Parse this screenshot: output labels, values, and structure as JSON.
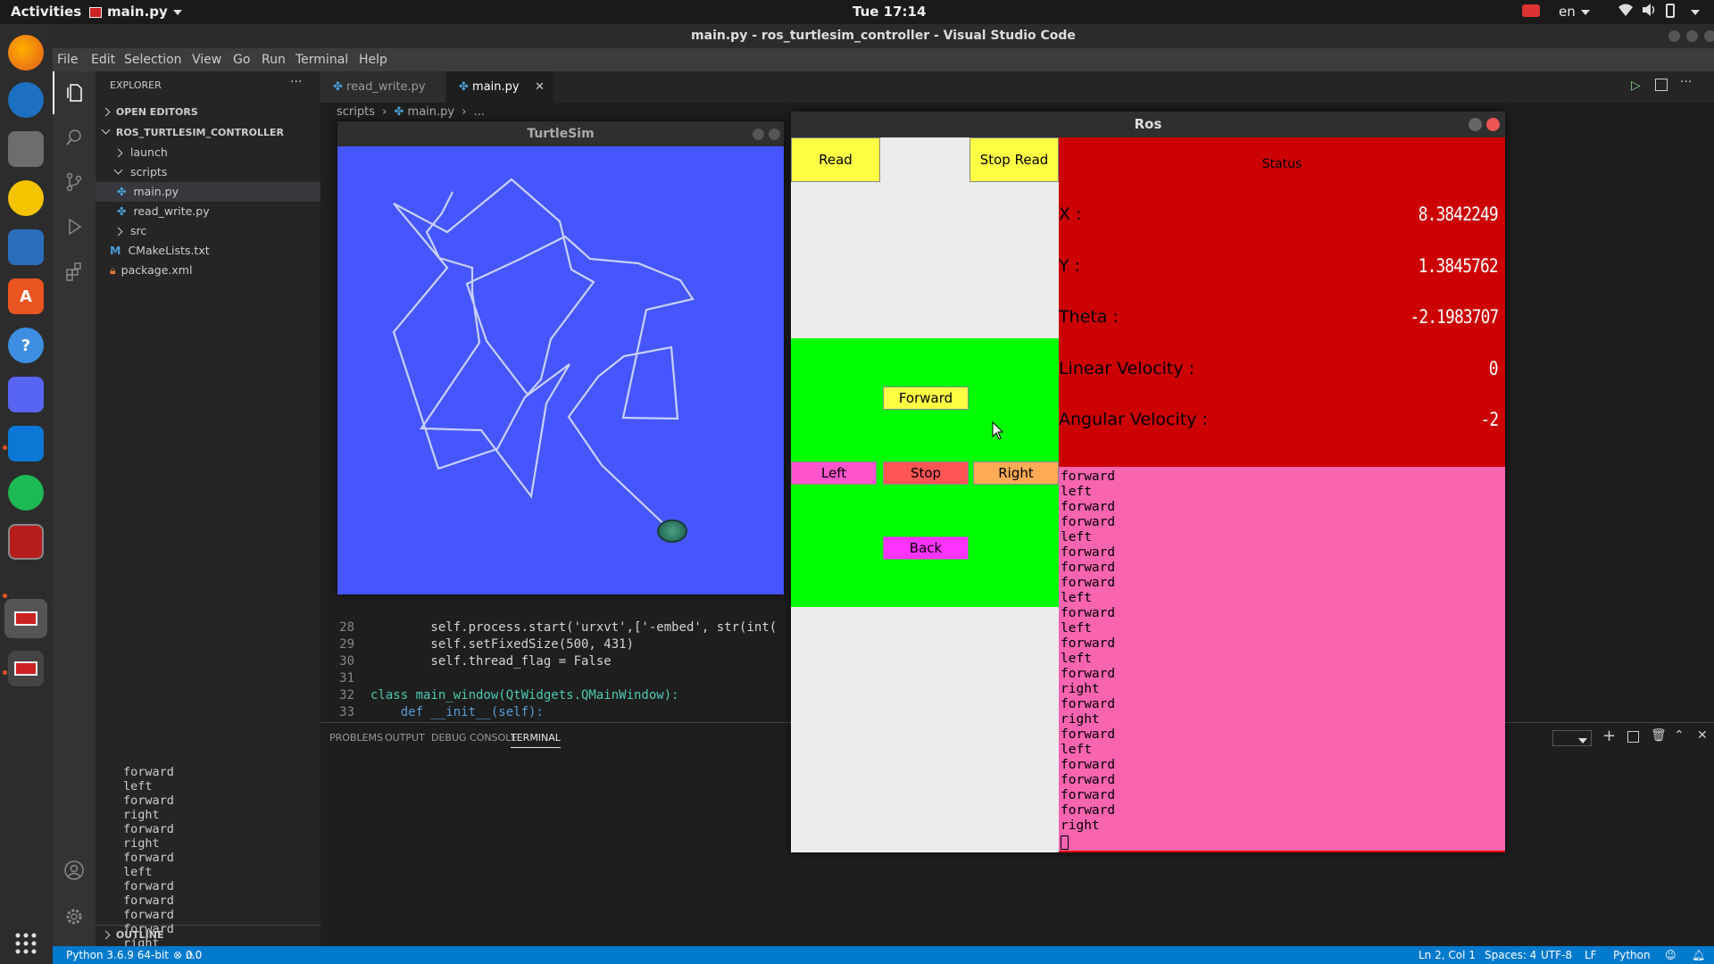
{
  "topbar": {
    "activities": "Activities",
    "app_menu": "main.py",
    "clock": "Tue 17:14",
    "language": "en"
  },
  "vscode": {
    "window_title": "main.py - ros_turtlesim_controller - Visual Studio Code",
    "menu": [
      "File",
      "Edit",
      "Selection",
      "View",
      "Go",
      "Run",
      "Terminal",
      "Help"
    ],
    "explorer": {
      "header": "EXPLORER",
      "open_editors": "OPEN EDITORS",
      "project": "ROS_TURTLESIM_CONTROLLER",
      "tree": [
        "launch",
        "scripts",
        "main.py",
        "read_write.py",
        "src",
        "CMakeLists.txt",
        "package.xml"
      ],
      "outline": "OUTLINE"
    },
    "tabs": [
      "read_write.py",
      "main.py"
    ],
    "breadcrumb": [
      "scripts",
      "main.py",
      "..."
    ],
    "code": [
      {
        "n": "28",
        "text": "        self.process.start('urxvt',['-embed', str(int("
      },
      {
        "n": "29",
        "text": "        self.setFixedSize(500, 431)"
      },
      {
        "n": "30",
        "text": "        self.thread_flag = False"
      },
      {
        "n": "31",
        "text": ""
      },
      {
        "n": "32",
        "text": "class main_window(QtWidgets.QMainWindow):"
      },
      {
        "n": "33",
        "text": "    def __init__(self):"
      }
    ],
    "panel_tabs": [
      "PROBLEMS",
      "OUTPUT",
      "DEBUG CONSOLE",
      "TERMINAL"
    ],
    "terminal_lines": [
      "forward",
      "left",
      "forward",
      "right",
      "forward",
      "right",
      "forward",
      "left",
      "forward",
      "forward",
      "forward",
      "forward",
      "right"
    ],
    "status": {
      "python": "Python 3.6.9 64-bit",
      "problems": "0",
      "warnings": "0",
      "position": "Ln 2, Col 1",
      "spaces": "Spaces: 4",
      "encoding": "UTF-8",
      "eol": "LF",
      "language": "Python"
    }
  },
  "turtlesim": {
    "title": "TurtleSim",
    "background": "#4556ff"
  },
  "ros": {
    "title": "Ros",
    "buttons": {
      "read": "Read",
      "stop_read": "Stop Read",
      "forward": "Forward",
      "left": "Left",
      "stop": "Stop",
      "right": "Right",
      "back": "Back"
    },
    "status": {
      "heading": "Status",
      "x_label": "X :",
      "x_value": "8.3842249",
      "y_label": "Y :",
      "y_value": "1.3845762",
      "theta_label": "Theta :",
      "theta_value": "-2.1983707",
      "linear_label": "Linear Velocity :",
      "linear_value": "0",
      "angular_label": "Angular Velocity :",
      "angular_value": "-2"
    },
    "log": [
      "forward",
      "left",
      "forward",
      "forward",
      "left",
      "forward",
      "forward",
      "forward",
      "left",
      "forward",
      "left",
      "forward",
      "left",
      "forward",
      "right",
      "forward",
      "right",
      "forward",
      "left",
      "forward",
      "forward",
      "forward",
      "forward",
      "right"
    ],
    "colors": {
      "status_bg": "#cc0000",
      "log_bg": "#f864b0",
      "pad_bg": "#00ff00",
      "yellow": "#ffff44",
      "pink_btn": "#ff55cc",
      "red_btn": "#ff5555",
      "orange_btn": "#ffaa55",
      "magenta_btn": "#ff33ff"
    }
  }
}
